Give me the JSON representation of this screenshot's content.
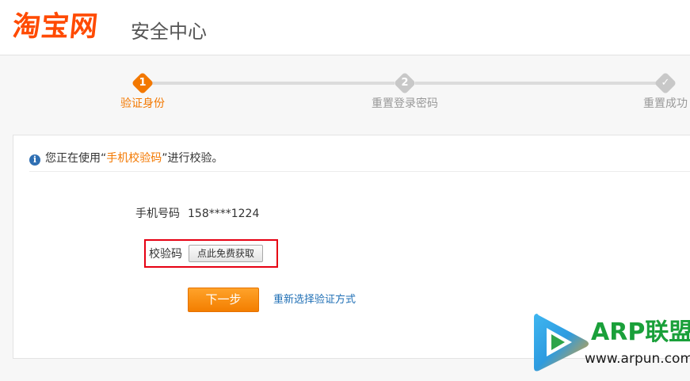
{
  "header": {
    "logo_text": "淘宝网",
    "subtitle": "安全中心"
  },
  "steps": [
    {
      "number": "1",
      "label": "验证身份",
      "state": "active"
    },
    {
      "number": "2",
      "label": "重置登录密码",
      "state": "pending"
    },
    {
      "number": "✓",
      "label": "重置成功",
      "state": "pending"
    }
  ],
  "notice": {
    "icon": "info-icon",
    "prefix": "您正在使用",
    "open_quote": "“",
    "method": "手机校验码",
    "close_quote": "”",
    "suffix": "进行校验。"
  },
  "form": {
    "phone_label": "手机号码",
    "phone_value": "158****1224",
    "code_label": "校验码",
    "get_code_button": "点此免费获取",
    "next_button": "下一步",
    "reselect_link": "重新选择验证方式"
  },
  "watermark": {
    "brand": "ARP联盟",
    "url": "www.arpun.com"
  },
  "colors": {
    "accent": "#f37800",
    "brand": "#ff4a00",
    "link": "#1f6fb5",
    "highlight_border": "#e60012",
    "inactive_step": "#c8c8c8"
  }
}
